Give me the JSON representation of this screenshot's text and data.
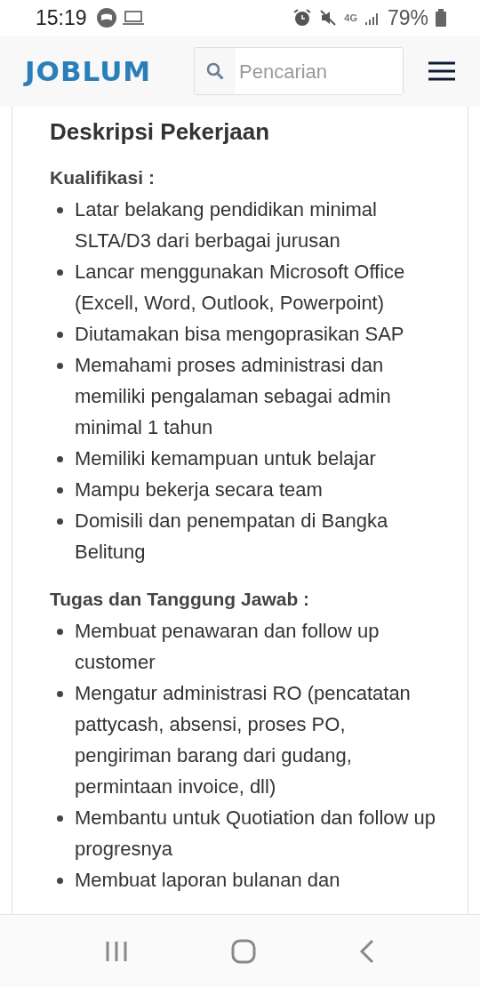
{
  "status_bar": {
    "time": "15:19",
    "network": "4G",
    "battery": "79%"
  },
  "header": {
    "logo": "JOBLUM",
    "search": {
      "placeholder": "Pencarian"
    }
  },
  "content": {
    "title": "Deskripsi Pekerjaan",
    "sections": [
      {
        "heading": "Kualifikasi :",
        "items": [
          "Latar belakang pendidikan minimal SLTA/D3 dari berbagai jurusan",
          "Lancar menggunakan Microsoft Office (Excell, Word, Outlook, Powerpoint)",
          "Diutamakan bisa mengoprasikan SAP",
          "Memahami proses administrasi dan memiliki pengalaman sebagai admin minimal 1 tahun",
          "Memiliki kemampuan untuk belajar",
          "Mampu bekerja secara team",
          "Domisili dan penempatan di Bangka Belitung"
        ]
      },
      {
        "heading": "Tugas dan Tanggung Jawab :",
        "items": [
          "Membuat penawaran dan follow up customer",
          "Mengatur administrasi RO (pencatatan pattycash, absensi, proses PO, pengiriman barang dari gudang, permintaan invoice, dll)",
          "Membantu untuk Quotiation dan follow up progresnya",
          "Membuat laporan bulanan dan"
        ]
      }
    ]
  }
}
